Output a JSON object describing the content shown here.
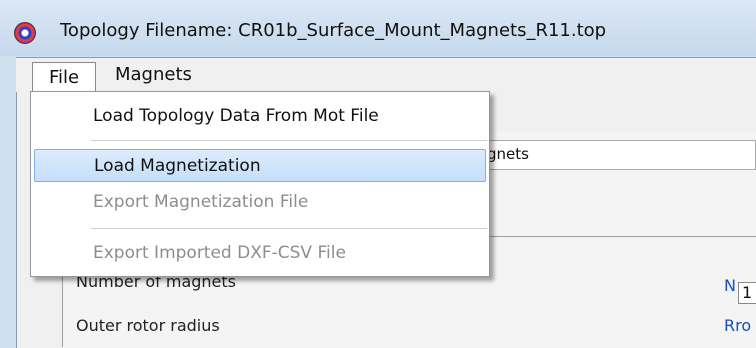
{
  "window": {
    "title": "Topology Filename: CR01b_Surface_Mount_Magnets_R11.top"
  },
  "menubar": {
    "file": "File",
    "magnets": "Magnets"
  },
  "file_menu": {
    "items": [
      {
        "label": "Load Topology Data From Mot File",
        "enabled": true
      },
      {
        "label": "Load Magnetization",
        "enabled": true,
        "highlighted": true
      },
      {
        "label": "Export Magnetization File",
        "enabled": false
      },
      {
        "label": "Export Imported DXF-CSV File",
        "enabled": false
      }
    ]
  },
  "form": {
    "name_field_value": "gnets",
    "rows": [
      {
        "label": "Number of magnets",
        "symbol": "N",
        "value": "1"
      },
      {
        "label": "Outer rotor radius",
        "symbol": "Rro"
      }
    ]
  },
  "colors": {
    "highlight": "#c4def9",
    "highlight_border": "#7fb1e6",
    "symbol_blue": "#1a4fb5",
    "disabled_text": "#8d8d8d"
  },
  "icons": {
    "app": "app-logo-icon"
  }
}
